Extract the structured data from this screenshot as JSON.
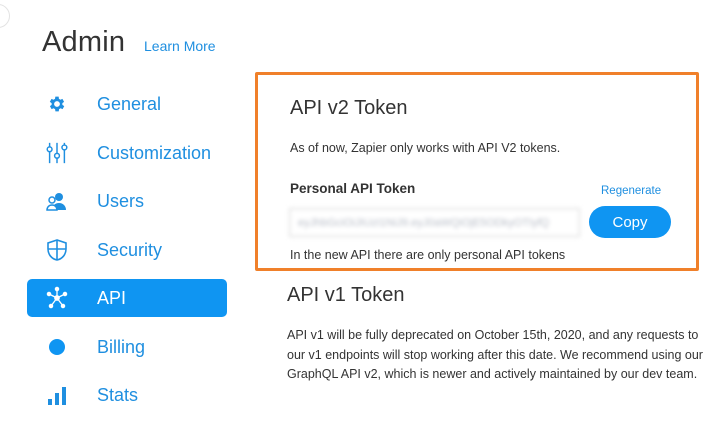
{
  "header": {
    "title": "Admin",
    "learn_more": "Learn More"
  },
  "sidebar": {
    "items": [
      {
        "label": "General",
        "icon": "gear-icon"
      },
      {
        "label": "Customization",
        "icon": "sliders-icon"
      },
      {
        "label": "Users",
        "icon": "users-icon"
      },
      {
        "label": "Security",
        "icon": "shield-icon"
      },
      {
        "label": "API",
        "icon": "network-icon",
        "active": true
      },
      {
        "label": "Billing",
        "icon": "billing-icon"
      },
      {
        "label": "Stats",
        "icon": "bar-chart-icon"
      }
    ]
  },
  "api_v2": {
    "title": "API v2 Token",
    "description": "As of now, Zapier only works with API V2 tokens.",
    "token_label": "Personal API Token",
    "regenerate_label": "Regenerate",
    "token_value": "eyJhbGciOiJIUzI1NiJ9.eyJ0aWQiOjE5ODkyOTIyfQ",
    "copy_label": "Copy",
    "note": "In the new API there are only personal API tokens"
  },
  "api_v1": {
    "title": "API v1 Token",
    "text": "API v1 will be fully deprecated on October 15th, 2020, and any requests to our v1 endpoints will stop working after this date. We recommend using our GraphQL API v2, which is newer and actively maintained by our dev team."
  },
  "colors": {
    "accent": "#0f95f2",
    "link": "#1f8fe0",
    "highlight_border": "#f0802a"
  }
}
